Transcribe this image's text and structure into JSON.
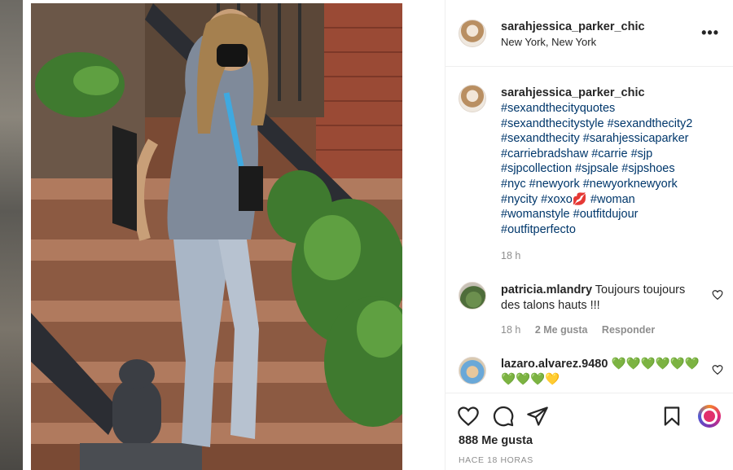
{
  "post": {
    "owner_username": "sarahjessica_parker_chic",
    "location": "New York, New York",
    "more_icon": "more-horizontal-icon"
  },
  "caption": {
    "username": "sarahjessica_parker_chic",
    "lines": [
      "#sexandthecityquotes",
      "#sexandthecitystyle #sexandthecity2",
      "#sexandthecity #sarahjessicaparker",
      "#carriebradshaw #carrie #sjp",
      "#sjpcollection #sjpsale #sjpshoes",
      "#nyc #newyork #newyorknewyork",
      "#nycity #xoxo💋 #woman",
      "#womanstyle #outfitdujour",
      "#outfitperfecto"
    ],
    "time": "18 h"
  },
  "comments": [
    {
      "username": "patricia.mlandry",
      "text": "Toujours toujours des talons hauts !!!",
      "time": "18 h",
      "likes": "2 Me gusta",
      "reply": "Responder"
    },
    {
      "username": "lazaro.alvarez.9480",
      "text": "💚💚💚💚💚💚💚💚💚💛"
    }
  ],
  "actions": {
    "likes_count": "888 Me gusta",
    "posted_ago": "HACE 18 HORAS"
  },
  "colors": {
    "hashtag": "#00376b",
    "text": "#262626",
    "muted": "#8e8e8e",
    "divider": "#efefef"
  }
}
